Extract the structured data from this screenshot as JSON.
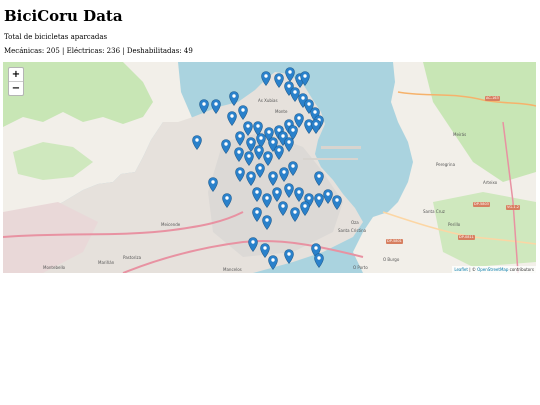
{
  "header": {
    "title": "BiciCoru Data",
    "subtitle": "Total de bicicletas aparcadas",
    "counts": "Mecánicas: 205 | Eléctricas: 236 | Deshabilitadas: 49"
  },
  "map": {
    "zoom_in_label": "+",
    "zoom_out_label": "−",
    "attribution": {
      "leaflet": "Leaflet",
      "separator": " | © ",
      "osm": "OpenStreetMap",
      "suffix": " contributors"
    },
    "place_labels": {
      "as_xubias": "As Xubias",
      "monte": "Monte",
      "meicende": "Meicende",
      "santa_cristina": "Santa Cristina",
      "oza": "Oza",
      "o_porto": "O Porto",
      "arteixo": "Arteixo",
      "peregrina": "Peregrina",
      "perillo": "Perillo",
      "santa_cruz": "Santa Cruz",
      "montebello": "Montebello",
      "mariñan": "Mariñán",
      "o_burgo": "O Burgo",
      "mancelos": "Mancelos",
      "meirás": "Meirás",
      "pastoriza": "Pastoriza"
    },
    "road_labels": {
      "ac_163": "AC-163",
      "dp_5801": "DP-5801",
      "dp_0811": "DP-0811",
      "vg_1_2": "VG-1.2",
      "dp_5803": "DP-5803"
    },
    "colors": {
      "water": "#aad3df",
      "land": "#f2efe9",
      "green": "#c8e6b5",
      "urban": "#e0dfdf",
      "marker": "#2a81cb",
      "motorway": "#e892a2"
    },
    "marker_icon": "map-pin-icon"
  }
}
